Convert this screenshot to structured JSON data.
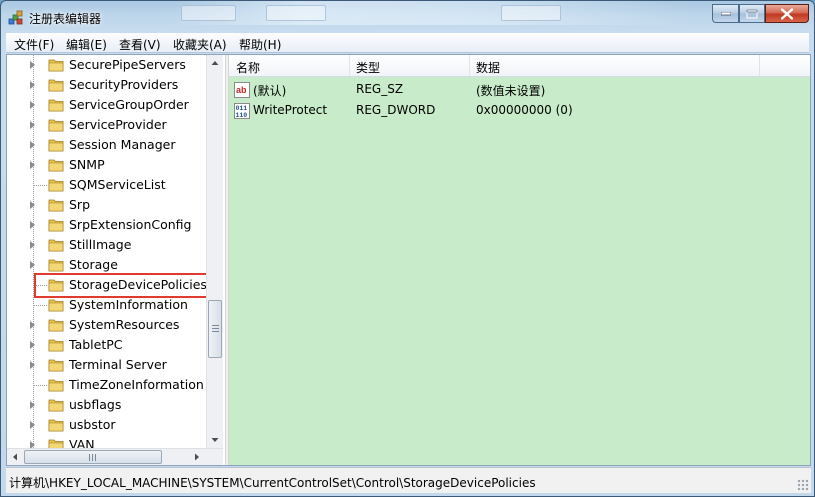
{
  "window": {
    "title": "注册表编辑器"
  },
  "menu": [
    "文件(F)",
    "编辑(E)",
    "查看(V)",
    "收藏夹(A)",
    "帮助(H)"
  ],
  "tree": {
    "items": [
      {
        "label": "SecurePipeServers",
        "expandable": true
      },
      {
        "label": "SecurityProviders",
        "expandable": true
      },
      {
        "label": "ServiceGroupOrder",
        "expandable": true
      },
      {
        "label": "ServiceProvider",
        "expandable": true
      },
      {
        "label": "Session Manager",
        "expandable": true
      },
      {
        "label": "SNMP",
        "expandable": true
      },
      {
        "label": "SQMServiceList",
        "expandable": false
      },
      {
        "label": "Srp",
        "expandable": true
      },
      {
        "label": "SrpExtensionConfig",
        "expandable": true
      },
      {
        "label": "StillImage",
        "expandable": true
      },
      {
        "label": "Storage",
        "expandable": true
      },
      {
        "label": "StorageDevicePolicies",
        "expandable": false,
        "selected": true
      },
      {
        "label": "SystemInformation",
        "expandable": false
      },
      {
        "label": "SystemResources",
        "expandable": true
      },
      {
        "label": "TabletPC",
        "expandable": true
      },
      {
        "label": "Terminal Server",
        "expandable": true
      },
      {
        "label": "TimeZoneInformation",
        "expandable": false
      },
      {
        "label": "usbflags",
        "expandable": true
      },
      {
        "label": "usbstor",
        "expandable": true
      },
      {
        "label": "VAN",
        "expandable": true
      }
    ]
  },
  "list": {
    "columns": [
      "名称",
      "类型",
      "数据"
    ],
    "rows": [
      {
        "name": "(默认)",
        "type": "REG_SZ",
        "data": "(数值未设置)",
        "icon": "string-value-icon"
      },
      {
        "name": "WriteProtect",
        "type": "REG_DWORD",
        "data": "0x00000000 (0)",
        "icon": "binary-value-icon"
      }
    ]
  },
  "status": {
    "path": "计算机\\HKEY_LOCAL_MACHINE\\SYSTEM\\CurrentControlSet\\Control\\StorageDevicePolicies"
  },
  "colors": {
    "list_background": "#c8ecc9",
    "selection_highlight": "#e23a2f",
    "folder": "#e8c24a"
  }
}
